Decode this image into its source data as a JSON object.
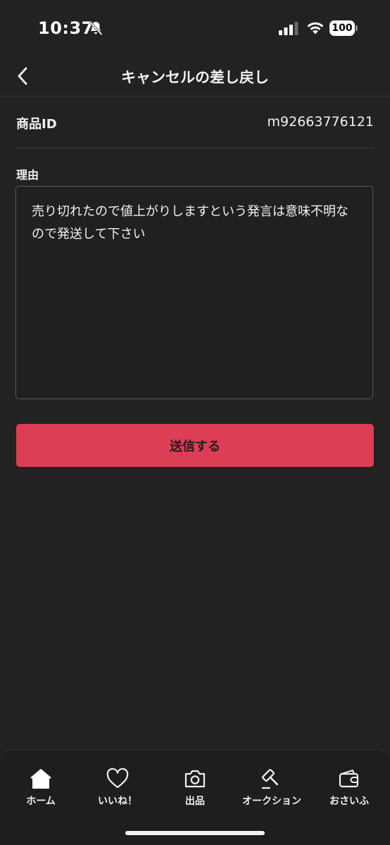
{
  "status_bar": {
    "time": "10:37",
    "battery": "100"
  },
  "header": {
    "title": "キャンセルの差し戻し"
  },
  "item": {
    "id_label": "商品ID",
    "id_value": "m92663776121"
  },
  "reason": {
    "label": "理由",
    "text": "売り切れたので値上がりしますという発言は意味不明なので発送して下さい"
  },
  "submit": {
    "label": "送信する"
  },
  "colors": {
    "background": "#222222",
    "accent": "#dc3e55",
    "text": "#f0f0f0"
  },
  "tabs": [
    {
      "label": "ホーム",
      "icon": "home-icon",
      "active": true
    },
    {
      "label": "いいね！",
      "icon": "heart-icon",
      "active": false
    },
    {
      "label": "出品",
      "icon": "camera-icon",
      "active": false
    },
    {
      "label": "オークション",
      "icon": "gavel-icon",
      "active": false
    },
    {
      "label": "おさいふ",
      "icon": "wallet-icon",
      "active": false
    }
  ]
}
